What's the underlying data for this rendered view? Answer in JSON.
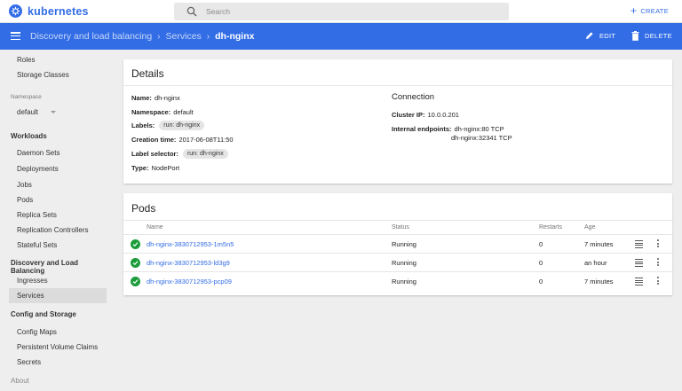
{
  "app": {
    "name": "kubernetes"
  },
  "search": {
    "placeholder": "Search"
  },
  "topbar": {
    "create_label": "CREATE"
  },
  "breadcrumb": {
    "items": [
      "Discovery and load balancing",
      "Services"
    ],
    "current": "dh-nginx"
  },
  "actions": {
    "edit_label": "EDIT",
    "delete_label": "DELETE"
  },
  "sidebar": {
    "top_items": [
      "Roles",
      "Storage Classes"
    ],
    "namespace_label": "Namespace",
    "namespace_value": "default",
    "workloads_header": "Workloads",
    "workloads": [
      "Daemon Sets",
      "Deployments",
      "Jobs",
      "Pods",
      "Replica Sets",
      "Replication Controllers",
      "Stateful Sets"
    ],
    "discovery_header": "Discovery and Load Balancing",
    "discovery": [
      "Ingresses",
      "Services"
    ],
    "config_header": "Config and Storage",
    "config": [
      "Config Maps",
      "Persistent Volume Claims",
      "Secrets"
    ],
    "about": "About"
  },
  "details": {
    "title": "Details",
    "name_key": "Name:",
    "name_value": "dh-nginx",
    "namespace_key": "Namespace:",
    "namespace_value": "default",
    "labels_key": "Labels:",
    "labels_value": "run: dh-nginx",
    "creation_key": "Creation time:",
    "creation_value": "2017-06-08T11:50",
    "selector_key": "Label selector:",
    "selector_value": "run: dh-nginx",
    "type_key": "Type:",
    "type_value": "NodePort",
    "connection_title": "Connection",
    "cluster_ip_key": "Cluster IP:",
    "cluster_ip_value": "10.0.0.201",
    "endpoints_key": "Internal endpoints:",
    "endpoints": [
      "dh-nginx:80 TCP",
      "dh-nginx:32341 TCP"
    ]
  },
  "pods": {
    "title": "Pods",
    "columns": {
      "name": "Name",
      "status": "Status",
      "restarts": "Restarts",
      "age": "Age"
    },
    "rows": [
      {
        "name": "dh-nginx-3830712953-1m5n5",
        "status": "Running",
        "restarts": "0",
        "age": "7 minutes"
      },
      {
        "name": "dh-nginx-3830712953-ld3g9",
        "status": "Running",
        "restarts": "0",
        "age": "an hour"
      },
      {
        "name": "dh-nginx-3830712953-pcp09",
        "status": "Running",
        "restarts": "0",
        "age": "7 minutes"
      }
    ]
  },
  "colors": {
    "brand": "#326ce5",
    "status_ok": "#1b9c3a"
  }
}
